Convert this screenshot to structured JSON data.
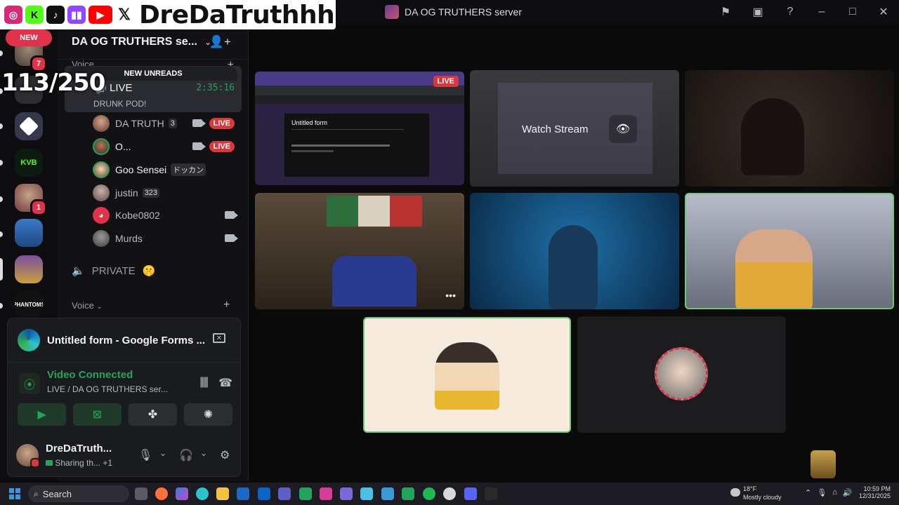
{
  "overlay": {
    "handle": "DreDaTruthhh",
    "socials": [
      {
        "icon": "instagram-icon",
        "color": "#d62976"
      },
      {
        "icon": "kick-icon",
        "color": "#53fc18"
      },
      {
        "icon": "tiktok-icon",
        "color": "#111111"
      },
      {
        "icon": "twitch-icon",
        "color": "#9146ff"
      },
      {
        "icon": "youtube-icon",
        "color": "#ff0000"
      },
      {
        "icon": "x-icon",
        "color": "#111111"
      }
    ],
    "counter": "113/250"
  },
  "window": {
    "title": "DA OG TRUTHERS server"
  },
  "rail": {
    "new_label": "NEW",
    "badges": [
      "7",
      "1"
    ]
  },
  "sidebar": {
    "server_name": "DA OG TRUTHERS se...",
    "voice_category": "Voice",
    "new_unreads": "NEW UNREADS",
    "live_channel": {
      "name": "LIVE",
      "timer": "2:35:16",
      "status": "DRUNK POD!"
    },
    "members": [
      {
        "name": "DA TRUTH",
        "badge": "3",
        "camera": true,
        "live": "LIVE"
      },
      {
        "name": "O...",
        "badge": "",
        "camera": true,
        "live": "LIVE"
      },
      {
        "name": "Goo Sensei",
        "badge": "ドッカン",
        "camera": false,
        "live": ""
      },
      {
        "name": "justin",
        "badge": "323",
        "camera": false,
        "live": ""
      },
      {
        "name": "Kobe0802",
        "badge": "",
        "camera": true,
        "live": ""
      },
      {
        "name": "Murds",
        "badge": "",
        "camera": true,
        "live": ""
      }
    ],
    "private_channel": "PRIVATE",
    "voice_category_2": "Voice"
  },
  "voice_panel": {
    "screen_share_title": "Untitled form - Google Forms ...",
    "connection_status": "Video Connected",
    "connection_channel": "LIVE / DA OG TRUTHERS ser...",
    "user": {
      "name": "DreDaTruth...",
      "status": "Sharing th...",
      "status_extra": "+1"
    }
  },
  "stage": {
    "stream_tile": {
      "live_label": "LIVE",
      "form_title": "Untitled form"
    },
    "watch_stream_label": "Watch Stream"
  },
  "taskbar": {
    "search_label": "Search",
    "weather_temp": "18°F",
    "weather_desc": "Mostly cloudy",
    "time": "10:59 PM",
    "date": "12/31/2025"
  }
}
